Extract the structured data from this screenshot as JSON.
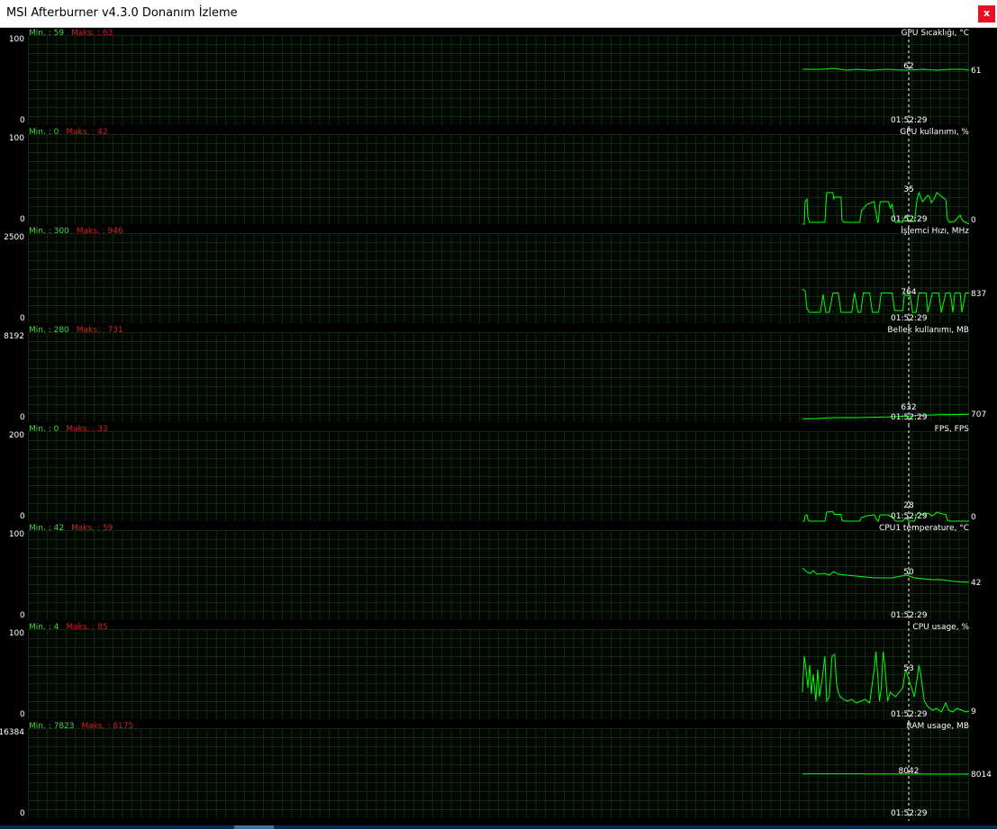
{
  "window": {
    "title": "MSI Afterburner v4.3.0 Donanım İzleme",
    "close_label": "x"
  },
  "min_prefix": "Min. : ",
  "max_prefix": "Maks. : ",
  "cursor_time": "01:52:29",
  "colors": {
    "background": "#000000",
    "grid": "#0e2a0e",
    "line": "#00ff00",
    "min_text": "#3fdc3f",
    "max_text": "#d42020",
    "cursor": "#ffffff"
  },
  "panels": [
    {
      "series_name": "GPU Sıcaklığı, °C",
      "min": "59",
      "max": "63",
      "y_max": "100",
      "y_min": "0",
      "cursor_value": "62",
      "current_value": "61",
      "trace": [
        [
          0,
          62
        ],
        [
          15,
          62
        ],
        [
          22,
          62
        ],
        [
          35,
          63
        ],
        [
          50,
          61
        ],
        [
          60,
          62
        ],
        [
          75,
          61
        ],
        [
          95,
          62
        ],
        [
          115,
          61
        ],
        [
          135,
          62
        ],
        [
          150,
          61
        ],
        [
          165,
          62
        ],
        [
          180,
          62
        ],
        [
          186,
          61
        ]
      ]
    },
    {
      "series_name": "GPU kullanımı, %",
      "min": "0",
      "max": "42",
      "y_max": "100",
      "y_min": "0",
      "cursor_value": "35",
      "current_value": "0",
      "trace": [
        [
          0,
          0
        ],
        [
          2,
          0
        ],
        [
          3,
          25
        ],
        [
          5,
          28
        ],
        [
          6,
          8
        ],
        [
          8,
          2
        ],
        [
          25,
          2
        ],
        [
          26,
          20
        ],
        [
          27,
          35
        ],
        [
          34,
          35
        ],
        [
          35,
          28
        ],
        [
          36,
          30
        ],
        [
          43,
          30
        ],
        [
          44,
          5
        ],
        [
          46,
          2
        ],
        [
          64,
          2
        ],
        [
          66,
          15
        ],
        [
          72,
          22
        ],
        [
          80,
          25
        ],
        [
          84,
          2
        ],
        [
          85,
          3
        ],
        [
          86,
          20
        ],
        [
          87,
          25
        ],
        [
          96,
          25
        ],
        [
          98,
          18
        ],
        [
          100,
          22
        ],
        [
          103,
          5
        ],
        [
          104,
          2
        ],
        [
          112,
          2
        ],
        [
          113,
          5
        ],
        [
          115,
          8
        ],
        [
          117,
          10
        ],
        [
          118,
          3
        ],
        [
          125,
          3
        ],
        [
          128,
          28
        ],
        [
          130,
          35
        ],
        [
          134,
          25
        ],
        [
          140,
          32
        ],
        [
          142,
          30
        ],
        [
          144,
          24
        ],
        [
          147,
          28
        ],
        [
          150,
          35
        ],
        [
          156,
          30
        ],
        [
          160,
          27
        ],
        [
          162,
          5
        ],
        [
          164,
          2
        ],
        [
          170,
          3
        ],
        [
          174,
          8
        ],
        [
          176,
          10
        ],
        [
          178,
          5
        ],
        [
          180,
          3
        ],
        [
          182,
          2
        ],
        [
          186,
          0
        ]
      ]
    },
    {
      "series_name": "İşlemci Hızı, MHz",
      "min": "300",
      "max": "946",
      "y_max": "2500",
      "y_min": "0",
      "cursor_value": "764",
      "current_value": "837",
      "trace": [
        [
          0,
          946
        ],
        [
          3,
          900
        ],
        [
          5,
          400
        ],
        [
          8,
          300
        ],
        [
          20,
          300
        ],
        [
          23,
          800
        ],
        [
          26,
          300
        ],
        [
          30,
          300
        ],
        [
          34,
          837
        ],
        [
          37,
          837
        ],
        [
          40,
          837
        ],
        [
          43,
          300
        ],
        [
          55,
          300
        ],
        [
          58,
          837
        ],
        [
          62,
          300
        ],
        [
          65,
          300
        ],
        [
          68,
          837
        ],
        [
          70,
          837
        ],
        [
          75,
          837
        ],
        [
          78,
          300
        ],
        [
          85,
          300
        ],
        [
          88,
          837
        ],
        [
          95,
          837
        ],
        [
          100,
          837
        ],
        [
          103,
          350
        ],
        [
          112,
          350
        ],
        [
          114,
          837
        ],
        [
          116,
          764
        ],
        [
          120,
          764
        ],
        [
          123,
          300
        ],
        [
          127,
          300
        ],
        [
          130,
          837
        ],
        [
          138,
          837
        ],
        [
          140,
          300
        ],
        [
          145,
          837
        ],
        [
          152,
          837
        ],
        [
          155,
          300
        ],
        [
          160,
          837
        ],
        [
          165,
          837
        ],
        [
          168,
          300
        ],
        [
          170,
          837
        ],
        [
          176,
          837
        ],
        [
          178,
          300
        ],
        [
          182,
          837
        ],
        [
          186,
          837
        ]
      ]
    },
    {
      "series_name": "Bellek kullanımı, MB",
      "min": "280",
      "max": "731",
      "y_max": "8192",
      "y_min": "0",
      "cursor_value": "632",
      "current_value": "707",
      "trace": [
        [
          0,
          300
        ],
        [
          8,
          320
        ],
        [
          12,
          310
        ],
        [
          26,
          380
        ],
        [
          35,
          400
        ],
        [
          50,
          420
        ],
        [
          60,
          410
        ],
        [
          75,
          440
        ],
        [
          80,
          450
        ],
        [
          95,
          470
        ],
        [
          100,
          500
        ],
        [
          110,
          530
        ],
        [
          120,
          560
        ],
        [
          125,
          600
        ],
        [
          135,
          620
        ],
        [
          150,
          660
        ],
        [
          160,
          690
        ],
        [
          175,
          700
        ],
        [
          186,
          707
        ]
      ]
    },
    {
      "series_name": "FPS, FPS",
      "min": "0",
      "max": "33",
      "y_max": "200",
      "y_min": "0",
      "cursor_value": "28",
      "current_value": "0",
      "trace": [
        [
          0,
          0
        ],
        [
          2,
          0
        ],
        [
          3,
          12
        ],
        [
          5,
          14
        ],
        [
          6,
          4
        ],
        [
          8,
          0
        ],
        [
          25,
          0
        ],
        [
          26,
          10
        ],
        [
          27,
          20
        ],
        [
          34,
          22
        ],
        [
          35,
          16
        ],
        [
          36,
          15
        ],
        [
          43,
          15
        ],
        [
          44,
          2
        ],
        [
          46,
          0
        ],
        [
          64,
          0
        ],
        [
          66,
          8
        ],
        [
          72,
          12
        ],
        [
          80,
          14
        ],
        [
          84,
          0
        ],
        [
          85,
          0
        ],
        [
          86,
          12
        ],
        [
          87,
          14
        ],
        [
          96,
          14
        ],
        [
          98,
          10
        ],
        [
          100,
          12
        ],
        [
          103,
          2
        ],
        [
          104,
          0
        ],
        [
          112,
          0
        ],
        [
          113,
          3
        ],
        [
          115,
          6
        ],
        [
          117,
          6
        ],
        [
          118,
          0
        ],
        [
          125,
          0
        ],
        [
          128,
          16
        ],
        [
          130,
          20
        ],
        [
          134,
          14
        ],
        [
          140,
          18
        ],
        [
          142,
          16
        ],
        [
          144,
          12
        ],
        [
          147,
          14
        ],
        [
          150,
          20
        ],
        [
          156,
          16
        ],
        [
          160,
          15
        ],
        [
          162,
          2
        ],
        [
          164,
          0
        ],
        [
          186,
          0
        ]
      ]
    },
    {
      "series_name": "CPU1 temperature, °C",
      "min": "42",
      "max": "59",
      "y_max": "100",
      "y_min": "0",
      "cursor_value": "50",
      "current_value": "42",
      "trace": [
        [
          0,
          58
        ],
        [
          3,
          55
        ],
        [
          6,
          53
        ],
        [
          9,
          52
        ],
        [
          12,
          55
        ],
        [
          16,
          51
        ],
        [
          25,
          52
        ],
        [
          30,
          50
        ],
        [
          35,
          54
        ],
        [
          40,
          51
        ],
        [
          50,
          50
        ],
        [
          60,
          49
        ],
        [
          70,
          48
        ],
        [
          80,
          47
        ],
        [
          88,
          47
        ],
        [
          100,
          47
        ],
        [
          110,
          49
        ],
        [
          116,
          50
        ],
        [
          125,
          47
        ],
        [
          135,
          46
        ],
        [
          145,
          45
        ],
        [
          155,
          45
        ],
        [
          170,
          43
        ],
        [
          186,
          42
        ]
      ]
    },
    {
      "series_name": "CPU usage, %",
      "min": "4",
      "max": "85",
      "y_max": "100",
      "y_min": "0",
      "cursor_value": "53",
      "current_value": "9",
      "trace": [
        [
          0,
          30
        ],
        [
          2,
          70
        ],
        [
          4,
          55
        ],
        [
          6,
          35
        ],
        [
          8,
          60
        ],
        [
          10,
          28
        ],
        [
          12,
          50
        ],
        [
          15,
          20
        ],
        [
          17,
          55
        ],
        [
          19,
          25
        ],
        [
          22,
          45
        ],
        [
          25,
          70
        ],
        [
          27,
          20
        ],
        [
          30,
          25
        ],
        [
          33,
          70
        ],
        [
          36,
          72
        ],
        [
          38,
          40
        ],
        [
          40,
          30
        ],
        [
          42,
          25
        ],
        [
          46,
          22
        ],
        [
          50,
          20
        ],
        [
          55,
          22
        ],
        [
          60,
          18
        ],
        [
          65,
          20
        ],
        [
          70,
          22
        ],
        [
          75,
          18
        ],
        [
          80,
          55
        ],
        [
          82,
          75
        ],
        [
          84,
          50
        ],
        [
          86,
          20
        ],
        [
          88,
          35
        ],
        [
          90,
          75
        ],
        [
          92,
          60
        ],
        [
          95,
          20
        ],
        [
          98,
          30
        ],
        [
          100,
          28
        ],
        [
          104,
          25
        ],
        [
          108,
          30
        ],
        [
          112,
          35
        ],
        [
          115,
          55
        ],
        [
          116,
          53
        ],
        [
          120,
          40
        ],
        [
          125,
          25
        ],
        [
          128,
          45
        ],
        [
          130,
          60
        ],
        [
          132,
          50
        ],
        [
          136,
          20
        ],
        [
          140,
          14
        ],
        [
          145,
          10
        ],
        [
          150,
          12
        ],
        [
          155,
          8
        ],
        [
          160,
          18
        ],
        [
          163,
          10
        ],
        [
          168,
          8
        ],
        [
          172,
          12
        ],
        [
          178,
          10
        ],
        [
          182,
          8
        ],
        [
          186,
          9
        ]
      ]
    },
    {
      "series_name": "RAM usage, MB",
      "min": "7823",
      "max": "8175",
      "y_max": "16384",
      "y_min": "0",
      "cursor_value": "8042",
      "current_value": "8014",
      "trace": [
        [
          0,
          8060
        ],
        [
          20,
          8060
        ],
        [
          40,
          8058
        ],
        [
          60,
          8055
        ],
        [
          80,
          8052
        ],
        [
          100,
          8050
        ],
        [
          116,
          8042
        ],
        [
          130,
          8040
        ],
        [
          150,
          8030
        ],
        [
          170,
          8020
        ],
        [
          186,
          8014
        ]
      ]
    }
  ]
}
